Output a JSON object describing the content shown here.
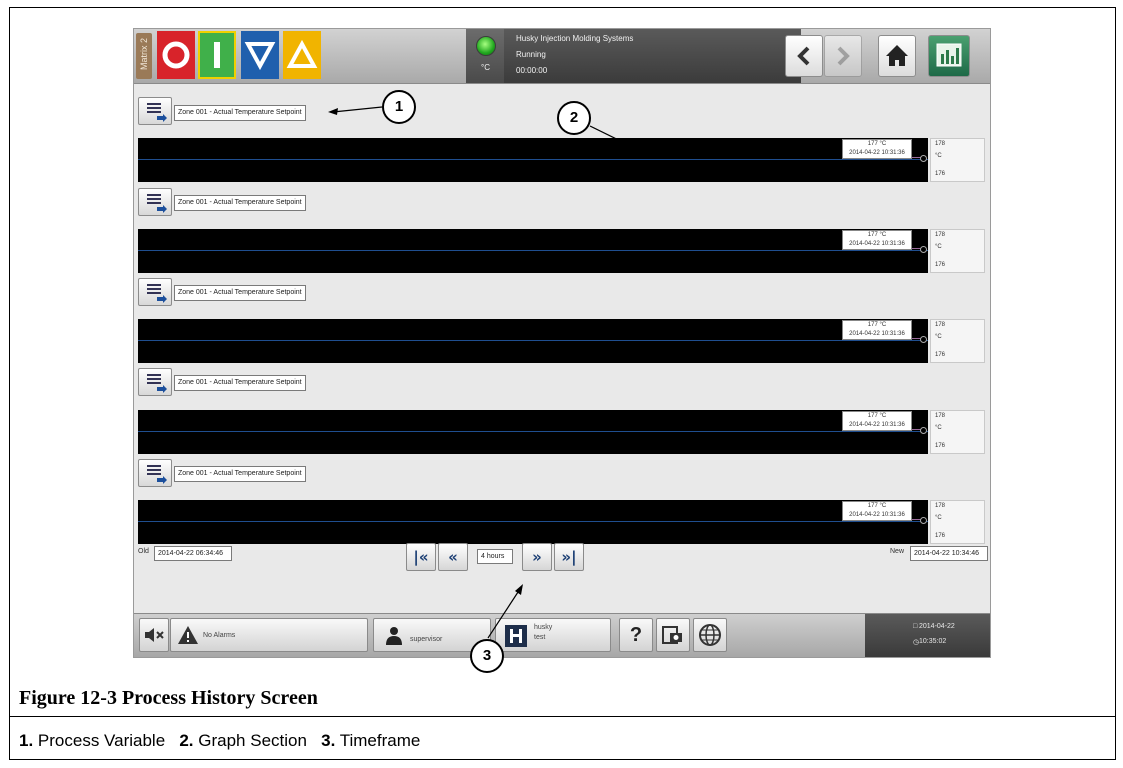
{
  "header": {
    "matrix_label": "Matrix 2",
    "company": "Husky Injection Molding Systems",
    "state": "Running",
    "elapsed": "00:00:00",
    "unit": "°C"
  },
  "graph_rows": [
    {
      "variable": "Zone 001 - Actual Temperature Setpoint",
      "value_label": "177 °C",
      "timestamp": "2014-04-22 10:31:36",
      "scale_max": "178",
      "scale_unit": "°C",
      "scale_min": "176"
    },
    {
      "variable": "Zone 001 - Actual Temperature Setpoint",
      "value_label": "177 °C",
      "timestamp": "2014-04-22 10:31:36",
      "scale_max": "178",
      "scale_unit": "°C",
      "scale_min": "176"
    },
    {
      "variable": "Zone 001 - Actual Temperature Setpoint",
      "value_label": "177 °C",
      "timestamp": "2014-04-22 10:31:36",
      "scale_max": "178",
      "scale_unit": "°C",
      "scale_min": "176"
    },
    {
      "variable": "Zone 001 - Actual Temperature Setpoint",
      "value_label": "177 °C",
      "timestamp": "2014-04-22 10:31:36",
      "scale_max": "178",
      "scale_unit": "°C",
      "scale_min": "176"
    },
    {
      "variable": "Zone 001 - Actual Temperature Setpoint",
      "value_label": "177 °C",
      "timestamp": "2014-04-22 10:31:36",
      "scale_max": "178",
      "scale_unit": "°C",
      "scale_min": "176"
    }
  ],
  "timeframe": {
    "old_label": "Old",
    "old_value": "2014-04-22 06:34:46",
    "window": "4 hours",
    "new_label": "New",
    "new_value": "2014-04-22 10:34:46",
    "first_glyph": "|«",
    "prev_glyph": "«",
    "next_glyph": "»",
    "last_glyph": "»|"
  },
  "footer": {
    "alarm_text": "No Alarms",
    "user_text": "supervisor",
    "profile_name": "husky",
    "profile_sub": "test",
    "help_glyph": "?",
    "date": "2014-04-22",
    "time": "10:35:02"
  },
  "callouts": [
    "1",
    "2",
    "3"
  ],
  "figure": {
    "title": "Figure 12-3 Process History Screen",
    "legend": [
      {
        "num": "1.",
        "text": "Process Variable"
      },
      {
        "num": "2.",
        "text": "Graph Section"
      },
      {
        "num": "3.",
        "text": "Timeframe"
      }
    ]
  }
}
